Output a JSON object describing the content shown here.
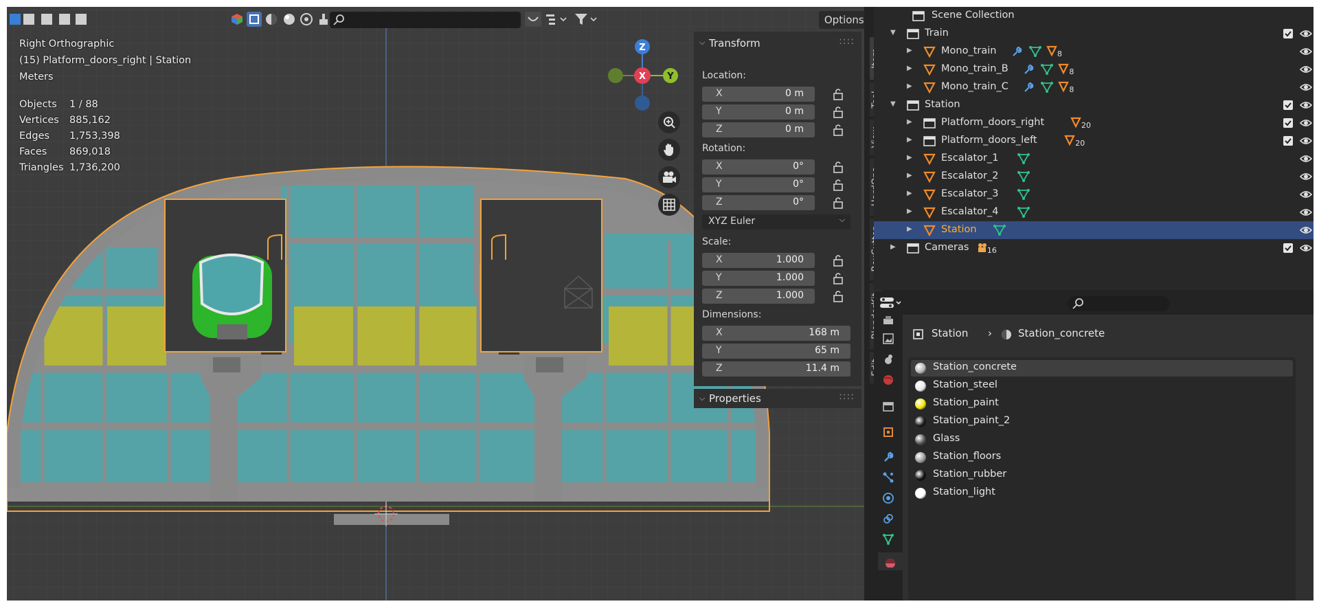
{
  "viewport": {
    "view_name": "Right Orthographic",
    "active_object": "(15) Platform_doors_right | Station",
    "units": "Meters",
    "stats": [
      {
        "label": "Objects",
        "value": "1 / 88"
      },
      {
        "label": "Vertices",
        "value": "885,162"
      },
      {
        "label": "Edges",
        "value": "1,753,398"
      },
      {
        "label": "Faces",
        "value": "869,018"
      },
      {
        "label": "Triangles",
        "value": "1,736,200"
      }
    ],
    "gizmo": {
      "z": "Z",
      "x": "X",
      "y": "Y"
    },
    "options_label": "Options"
  },
  "npanel": {
    "transform_title": "Transform",
    "location_label": "Location:",
    "location": [
      {
        "axis": "X",
        "value": "0 m"
      },
      {
        "axis": "Y",
        "value": "0 m"
      },
      {
        "axis": "Z",
        "value": "0 m"
      }
    ],
    "rotation_label": "Rotation:",
    "rotation": [
      {
        "axis": "X",
        "value": "0°"
      },
      {
        "axis": "Y",
        "value": "0°"
      },
      {
        "axis": "Z",
        "value": "0°"
      }
    ],
    "rotation_mode": "XYZ Euler",
    "scale_label": "Scale:",
    "scale": [
      {
        "axis": "X",
        "value": "1.000"
      },
      {
        "axis": "Y",
        "value": "1.000"
      },
      {
        "axis": "Z",
        "value": "1.000"
      }
    ],
    "dimensions_label": "Dimensions:",
    "dimensions": [
      {
        "axis": "X",
        "value": "168 m"
      },
      {
        "axis": "Y",
        "value": "65 m"
      },
      {
        "axis": "Z",
        "value": "11.4 m"
      }
    ],
    "properties_title": "Properties",
    "tabs": [
      "Item",
      "Tool",
      "View",
      "HardOps",
      "BoxCutter",
      "BlenderKit",
      "Edit"
    ]
  },
  "outliner": {
    "root": "Scene Collection",
    "rows": [
      {
        "label": "Train",
        "type": "collection",
        "level": 1
      },
      {
        "label": "Mono_train",
        "type": "mesh",
        "level": 2,
        "badge": "8"
      },
      {
        "label": "Mono_train_B",
        "type": "mesh",
        "level": 2,
        "badge": "8"
      },
      {
        "label": "Mono_train_C",
        "type": "mesh",
        "level": 2,
        "badge": "8"
      },
      {
        "label": "Station",
        "type": "collection",
        "level": 1
      },
      {
        "label": "Platform_doors_right",
        "type": "collection",
        "level": 2,
        "badge": "20"
      },
      {
        "label": "Platform_doors_left",
        "type": "collection",
        "level": 2,
        "badge": "20"
      },
      {
        "label": "Escalator_1",
        "type": "mesh",
        "level": 2
      },
      {
        "label": "Escalator_2",
        "type": "mesh",
        "level": 2
      },
      {
        "label": "Escalator_3",
        "type": "mesh",
        "level": 2
      },
      {
        "label": "Escalator_4",
        "type": "mesh",
        "level": 2
      },
      {
        "label": "Station",
        "type": "mesh",
        "level": 2,
        "selected": true
      },
      {
        "label": "Cameras",
        "type": "collection",
        "level": 1,
        "badge": "16"
      }
    ]
  },
  "properties": {
    "breadcrumb": [
      "Station",
      "Station_concrete"
    ],
    "material_slots": [
      {
        "name": "Station_concrete",
        "color": "#b5b5b5",
        "active": true
      },
      {
        "name": "Station_steel",
        "color": "#e8e8e8"
      },
      {
        "name": "Station_paint",
        "color": "#f2e600"
      },
      {
        "name": "Station_paint_2",
        "color": "#1a1a1a"
      },
      {
        "name": "Glass",
        "color": "#555555"
      },
      {
        "name": "Station_floors",
        "color": "#9a9a9a"
      },
      {
        "name": "Station_rubber",
        "color": "#111111"
      },
      {
        "name": "Station_light",
        "color": "#ffffff"
      }
    ]
  },
  "colors": {
    "selection_outline": "#f4a33a",
    "glass": "#55a3a7",
    "paint": "#b5b53a",
    "concrete": "#8e8e8e",
    "train_green": "#2db52b",
    "selected_row": "#334d80",
    "selected_text": "#ffaf29"
  },
  "icons": {
    "mesh": "mesh-triangle-icon",
    "collection": "collection-box-icon",
    "modifier": "wrench-icon",
    "vertex": "vertex-group-icon",
    "visibility": "eye-icon",
    "camera": "camera-icon"
  }
}
